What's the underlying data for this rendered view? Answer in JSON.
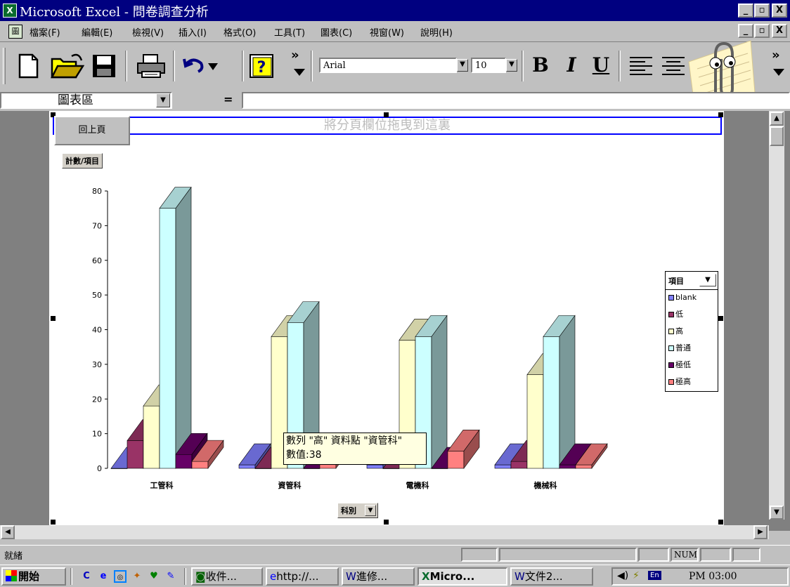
{
  "window": {
    "title": "Microsoft Excel - 問卷調查分析",
    "app_icon": "excel-icon",
    "controls": [
      "_",
      "▫",
      "X"
    ]
  },
  "menubar": {
    "items": [
      "檔案(F)",
      "編輯(E)",
      "檢視(V)",
      "插入(I)",
      "格式(O)",
      "工具(T)",
      "圖表(C)",
      "視窗(W)",
      "說明(H)"
    ],
    "doc_controls": [
      "_",
      "▫",
      "X"
    ]
  },
  "toolbar": {
    "font_name": "Arial",
    "font_size": "10",
    "bold": "B",
    "italic": "I",
    "underline": "U",
    "more": "»"
  },
  "formula_bar": {
    "name_box": "圖表區",
    "equals": "="
  },
  "pivot": {
    "drop_zone_text": "將分頁欄位拖曳到這裏",
    "back_button": "回上頁",
    "data_field": "計數/項目",
    "category_field": "科別",
    "series_field": "項目"
  },
  "tooltip": {
    "line1": "數列 \"高\" 資料點 \"資管科\"",
    "line2": "數值:38"
  },
  "chart_data": {
    "type": "bar",
    "categories": [
      "工管科",
      "資管科",
      "電機科",
      "機械科"
    ],
    "series": [
      {
        "name": "blank",
        "values": [
          0,
          1,
          1,
          1
        ],
        "color": "#8080ff"
      },
      {
        "name": "低",
        "values": [
          8,
          0,
          0,
          2
        ],
        "color": "#993366"
      },
      {
        "name": "高",
        "values": [
          18,
          38,
          37,
          27
        ],
        "color": "#ffffcc"
      },
      {
        "name": "普通",
        "values": [
          75,
          42,
          38,
          38
        ],
        "color": "#ccffff"
      },
      {
        "name": "極低",
        "values": [
          4,
          0,
          0,
          1
        ],
        "color": "#660066"
      },
      {
        "name": "極高",
        "values": [
          2,
          2,
          5,
          1
        ],
        "color": "#ff8080"
      }
    ],
    "yticks": [
      "0",
      "10",
      "20",
      "30",
      "40",
      "50",
      "60",
      "70",
      "80"
    ],
    "ylim": [
      0,
      80
    ],
    "legend_position": "right",
    "grid": false
  },
  "statusbar": {
    "ready": "就緒",
    "num": "NUM"
  },
  "taskbar": {
    "start": "開始",
    "tasks": [
      "收件...",
      "http://...",
      "進修...",
      "Micro...",
      "文件2..."
    ],
    "tray_lang": "En",
    "clock": "PM 03:00"
  }
}
